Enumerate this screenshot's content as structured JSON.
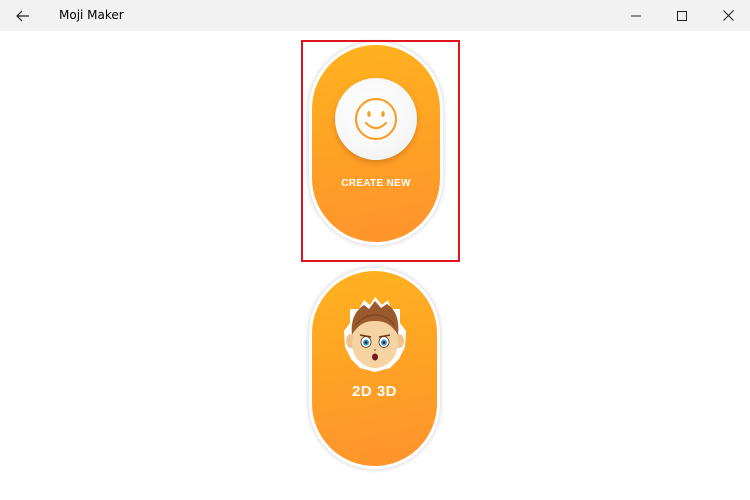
{
  "window": {
    "title": "Moji Maker",
    "controls": [
      "minimize",
      "maximize",
      "close"
    ]
  },
  "main": {
    "cards": [
      {
        "label": "CREATE NEW",
        "icon": "smiley-icon"
      },
      {
        "label": "2D 3D",
        "icon": "avatar-boy"
      }
    ]
  },
  "colors": {
    "card_gradient_top": "#ffb31f",
    "card_gradient_bottom": "#ff932c",
    "highlight_border": "#e0141e",
    "titlebar_bg": "#f2f2f2"
  }
}
